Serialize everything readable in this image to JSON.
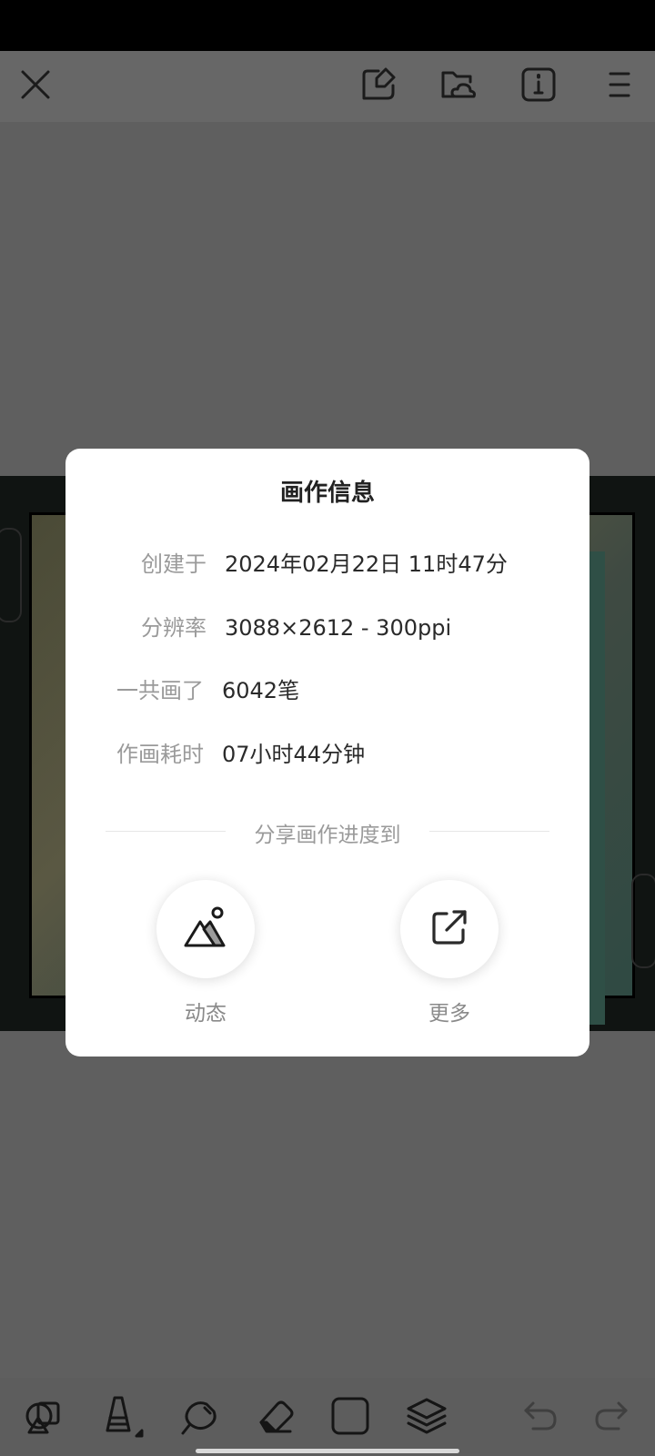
{
  "dialog": {
    "title": "画作信息",
    "rows": [
      {
        "label": "创建于",
        "value": "2024年02月22日 11时47分"
      },
      {
        "label": "分辨率",
        "value": "3088×2612 - 300ppi"
      },
      {
        "label": "一共画了",
        "value": "6042笔"
      },
      {
        "label": "作画耗时",
        "value": "07小时44分钟"
      }
    ],
    "share_heading": "分享画作进度到",
    "share": [
      {
        "label": "动态",
        "icon": "mountain-icon"
      },
      {
        "label": "更多",
        "icon": "external-link-icon"
      }
    ]
  },
  "topbar": {
    "icons": [
      "close-icon",
      "edit-canvas-icon",
      "cloud-folder-icon",
      "info-icon",
      "menu-icon"
    ]
  },
  "toolbar": {
    "icons": [
      "shapes-icon",
      "brush-icon",
      "smudge-icon",
      "eraser-icon",
      "color-swatch-icon",
      "layers-icon",
      "undo-icon",
      "redo-icon"
    ]
  },
  "colors": {
    "overlay": "#5f5f5f",
    "dialog_bg": "#ffffff",
    "label_gray": "#9a9a9a",
    "value_dark": "#2a2a2a"
  }
}
